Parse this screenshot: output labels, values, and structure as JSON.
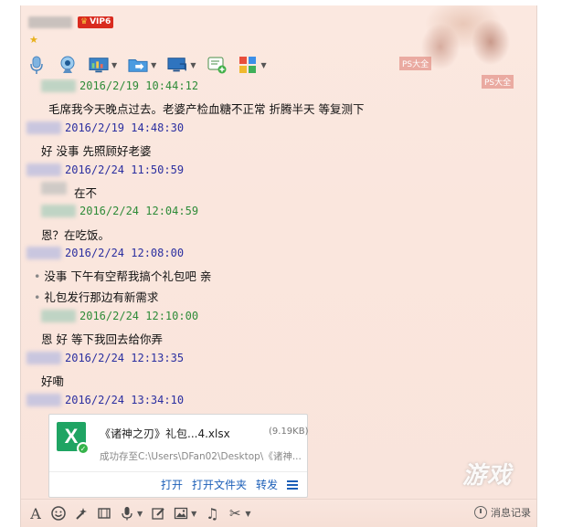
{
  "header": {
    "vip_label": "VIP6"
  },
  "art": {
    "sign1": "PS大全",
    "sign2": "PS大全"
  },
  "toolbar_top": {
    "icons": [
      "microphone-icon",
      "video-camera-icon",
      "screen-share-icon",
      "folder-transfer-icon",
      "remote-desktop-icon",
      "new-chat-icon",
      "apps-grid-icon"
    ]
  },
  "messages": [
    {
      "time": "2016/2/19 10:44:12",
      "color": "green",
      "text": "毛席我今天晚点过去。老婆产检血糖不正常 折腾半天 等复测下"
    },
    {
      "time": "2016/2/19 14:48:30",
      "color": "blue",
      "text": "好 没事   先照顾好老婆"
    },
    {
      "time": "2016/2/24 11:50:59",
      "color": "blue",
      "text": ""
    },
    {
      "time": "2016/2/24 12:04:59",
      "color": "green",
      "text": "在不"
    },
    {
      "time": "",
      "color": "",
      "text": "恩？在吃饭。"
    },
    {
      "time": "2016/2/24 12:08:00",
      "color": "blue",
      "text": "没事  下午有空帮我搞个礼包吧  亲"
    },
    {
      "time": "",
      "color": "",
      "text": "礼包发行那边有新需求"
    },
    {
      "time": "2016/2/24 12:10:00",
      "color": "green",
      "text": "恩 好 等下我回去给你弄"
    },
    {
      "time": "2016/2/24 12:13:35",
      "color": "blue",
      "text": "好嘞"
    },
    {
      "time": "2016/2/24 13:34:10",
      "color": "blue",
      "text": ""
    }
  ],
  "file_card": {
    "icon_letter": "X",
    "name": "《诸神之刃》礼包...4.xlsx",
    "size": "(9.19KB)",
    "path": "成功存至C:\\Users\\DFan02\\Desktop\\《诸神...",
    "actions": {
      "open": "打开",
      "open_folder": "打开文件夹",
      "forward": "转发"
    }
  },
  "toolbar_bottom": {
    "history_label": "消息记录"
  },
  "watermark": "游戏"
}
